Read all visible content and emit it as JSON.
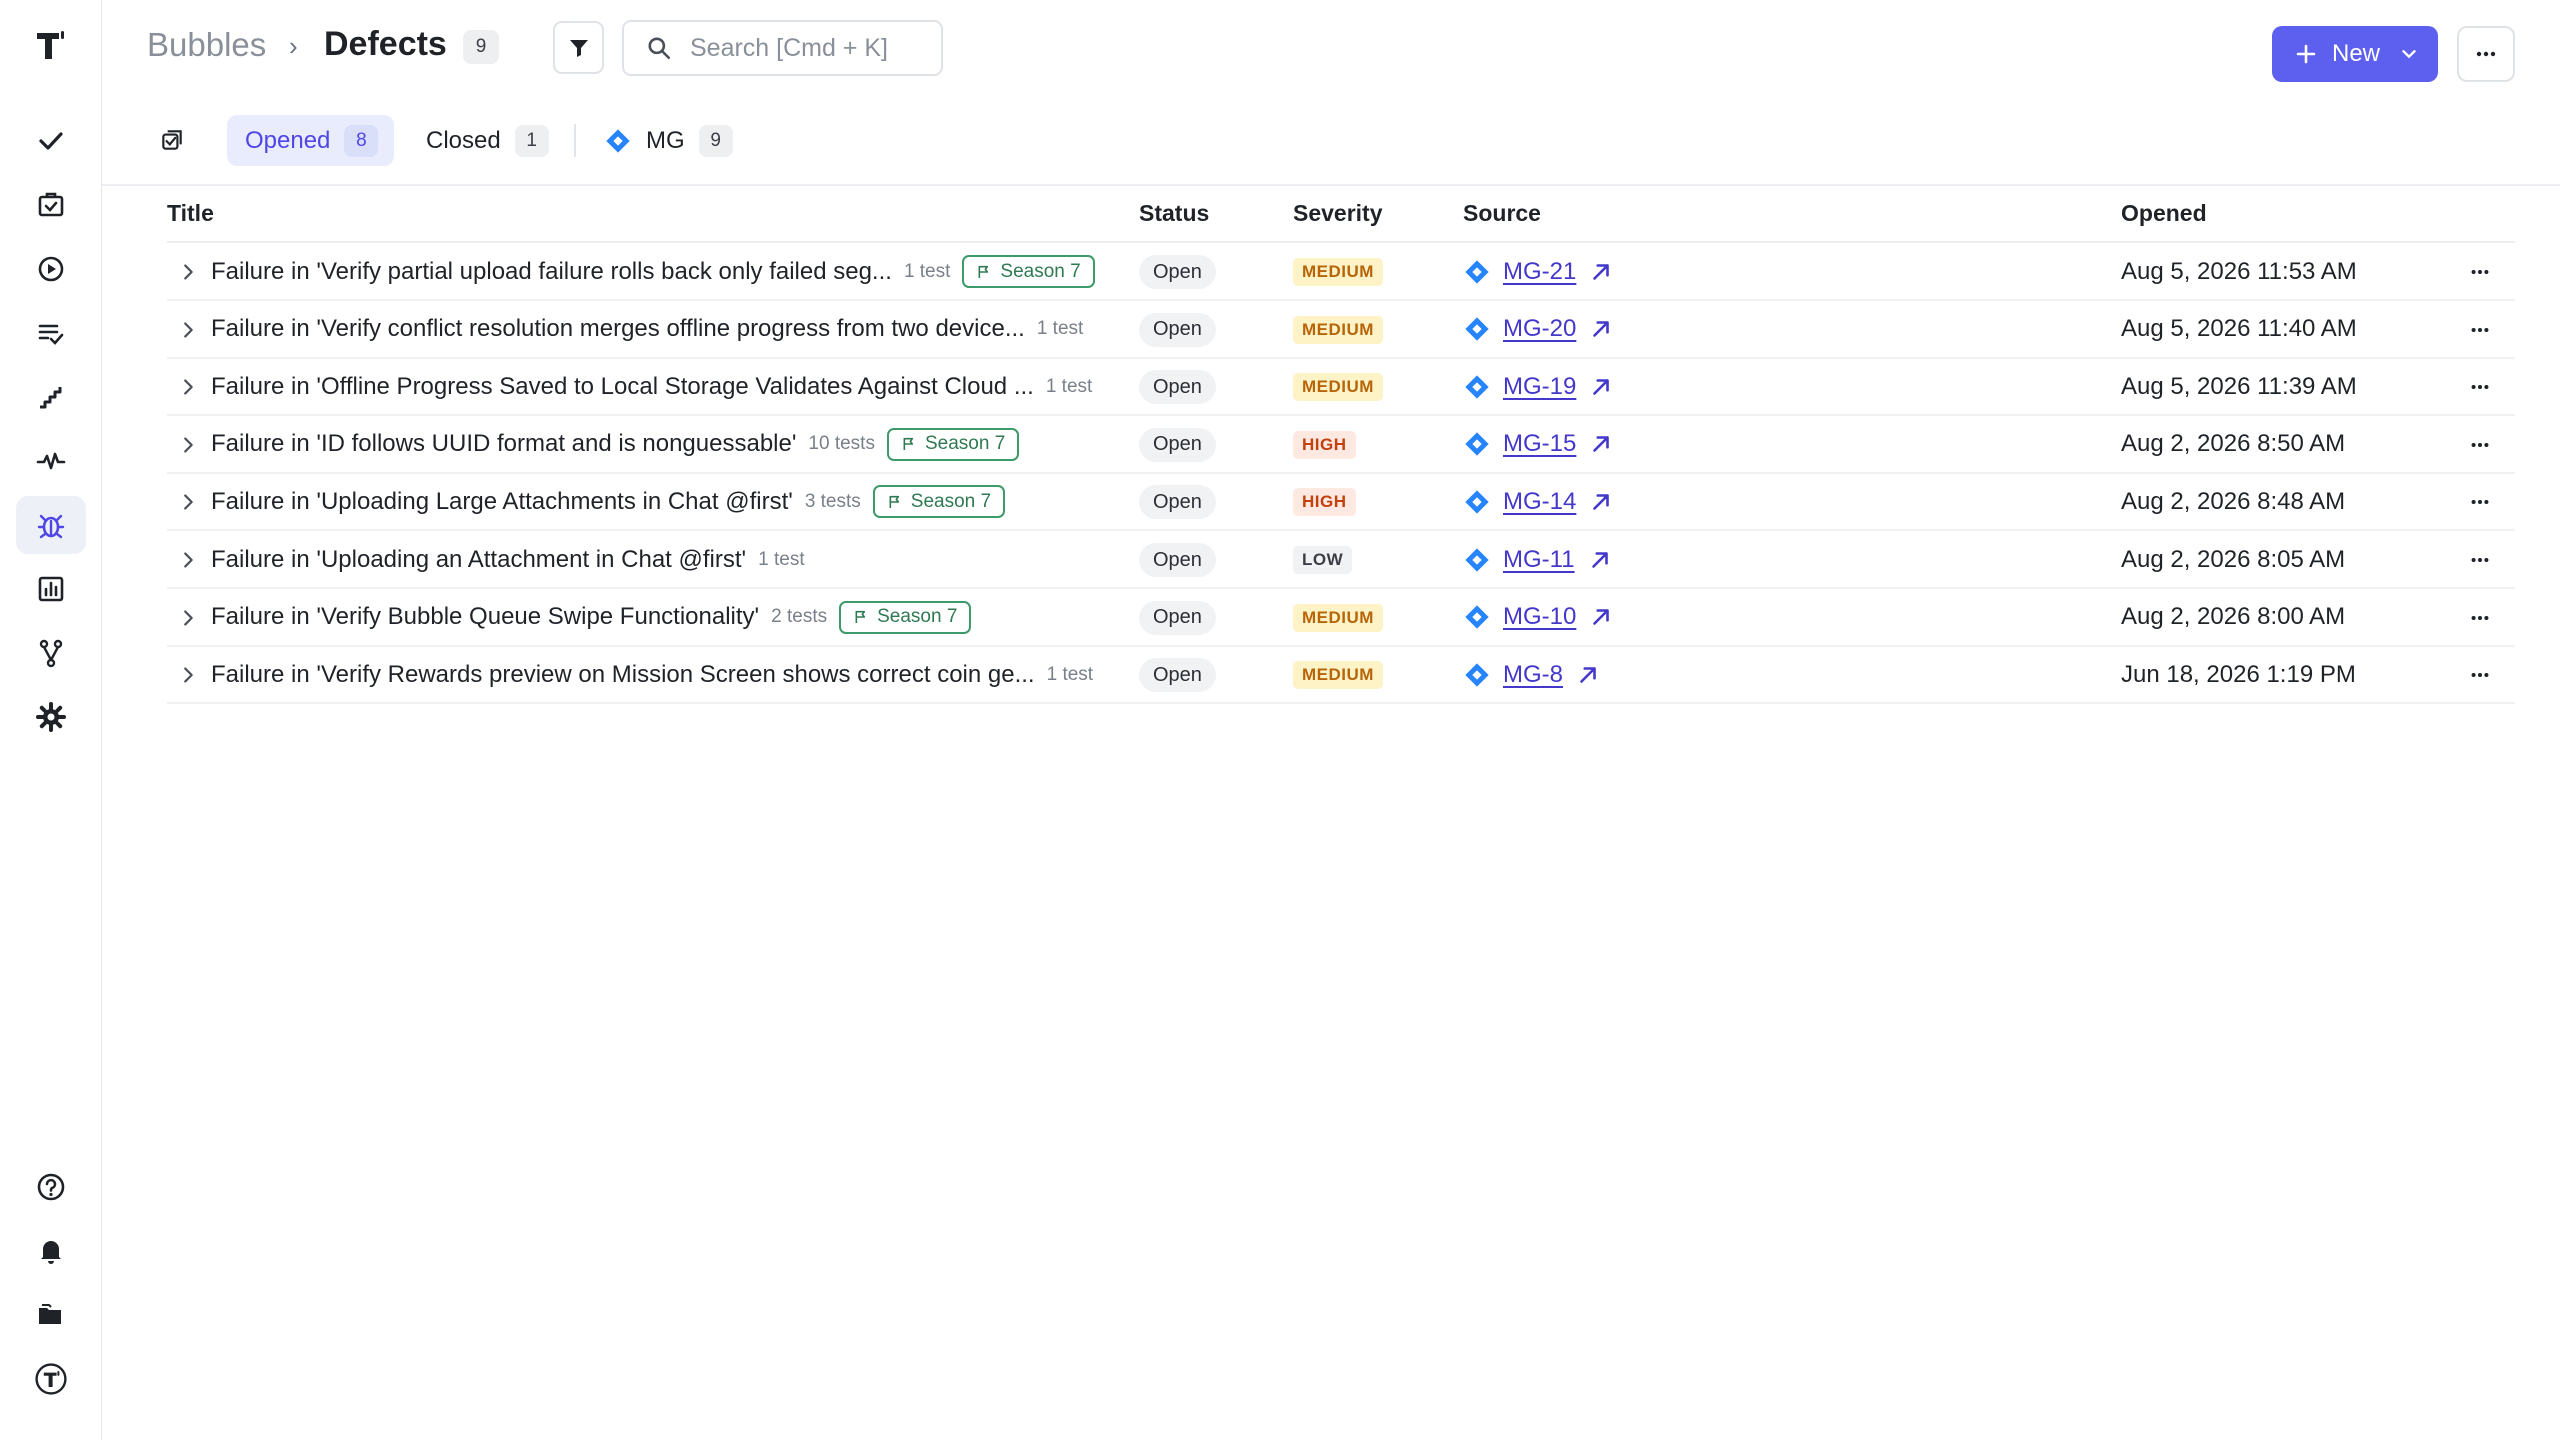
{
  "header": {
    "breadcrumb_root": "Bubbles",
    "breadcrumb_sep": "›",
    "title": "Defects",
    "count": "9",
    "search_placeholder": "Search [Cmd + K]",
    "new_label": "New"
  },
  "tabs": [
    {
      "label": "Opened",
      "count": "8",
      "active": true
    },
    {
      "label": "Closed",
      "count": "1",
      "active": false
    },
    {
      "label": "MG",
      "count": "9",
      "active": false
    }
  ],
  "columns": {
    "title": "Title",
    "status": "Status",
    "severity": "Severity",
    "source": "Source",
    "opened": "Opened"
  },
  "rows": [
    {
      "title": "Failure in 'Verify partial upload failure rolls back only failed seg...",
      "tests": "1 test",
      "tag": "Season 7",
      "status": "Open",
      "severity": "MEDIUM",
      "source": "MG-21",
      "opened": "Aug 5, 2026 11:53 AM"
    },
    {
      "title": "Failure in 'Verify conflict resolution merges offline progress from two device...",
      "tests": "1 test",
      "tag": "",
      "status": "Open",
      "severity": "MEDIUM",
      "source": "MG-20",
      "opened": "Aug 5, 2026 11:40 AM"
    },
    {
      "title": "Failure in 'Offline Progress Saved to Local Storage Validates Against Cloud ...",
      "tests": "1 test",
      "tag": "",
      "status": "Open",
      "severity": "MEDIUM",
      "source": "MG-19",
      "opened": "Aug 5, 2026 11:39 AM"
    },
    {
      "title": "Failure in 'ID follows UUID format and is nonguessable'",
      "tests": "10 tests",
      "tag": "Season 7",
      "status": "Open",
      "severity": "HIGH",
      "source": "MG-15",
      "opened": "Aug 2, 2026 8:50 AM"
    },
    {
      "title": "Failure in 'Uploading Large Attachments in Chat @first'",
      "tests": "3 tests",
      "tag": "Season 7",
      "status": "Open",
      "severity": "HIGH",
      "source": "MG-14",
      "opened": "Aug 2, 2026 8:48 AM"
    },
    {
      "title": "Failure in 'Uploading an Attachment in Chat @first'",
      "tests": "1 test",
      "tag": "",
      "status": "Open",
      "severity": "LOW",
      "source": "MG-11",
      "opened": "Aug 2, 2026 8:05 AM"
    },
    {
      "title": "Failure in 'Verify Bubble Queue Swipe Functionality'",
      "tests": "2 tests",
      "tag": "Season 7",
      "status": "Open",
      "severity": "MEDIUM",
      "source": "MG-10",
      "opened": "Aug 2, 2026 8:00 AM"
    },
    {
      "title": "Failure in 'Verify Rewards preview on Mission Screen shows correct coin ge...",
      "tests": "1 test",
      "tag": "",
      "status": "Open",
      "severity": "MEDIUM",
      "source": "MG-8",
      "opened": "Jun 18, 2026 1:19 PM"
    }
  ],
  "sidebar": {
    "top_items": [
      "tests-icon",
      "suites-icon",
      "runs-icon",
      "plans-icon",
      "steps-icon",
      "analytics-pulse-icon",
      "defects-bug-icon",
      "reports-icon",
      "branches-icon",
      "settings-icon"
    ],
    "bottom_items": [
      "help-icon",
      "notifications-icon",
      "projects-icon",
      "account-icon"
    ],
    "active": "defects-bug-icon"
  },
  "colors": {
    "accent": "#5d5fef",
    "link": "#4338ca",
    "season_tag": "#3d9a6a",
    "jira_blue": "#2684ff"
  }
}
